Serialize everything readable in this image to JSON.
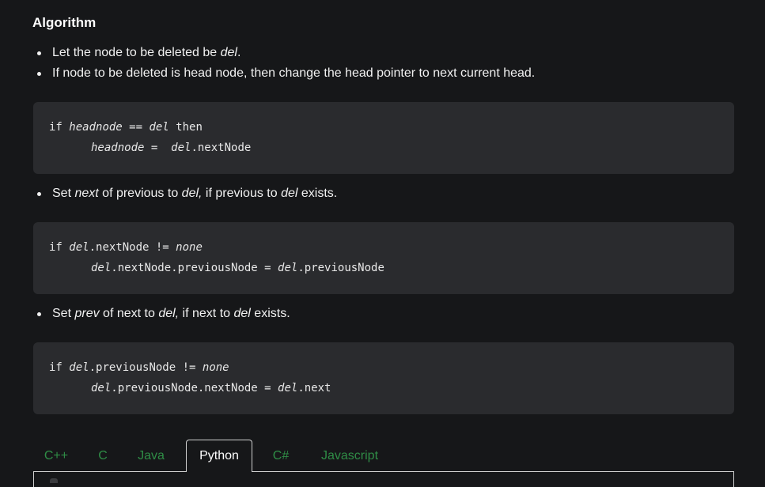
{
  "heading": "Algorithm",
  "bullets1": {
    "b1": {
      "t1": "Let the node to be deleted be ",
      "i1": "del",
      "t2": "."
    },
    "b2": {
      "t1": "If node to be deleted is head node, then change the head pointer to next current head."
    }
  },
  "code1": {
    "l1": {
      "kw": "if ",
      "v1": "headnode",
      "op": " == ",
      "v2": "del",
      "t": " then"
    },
    "l2": {
      "v1": "headnode",
      "op": " =  ",
      "v2": "del",
      "t": ".nextNode"
    }
  },
  "bullet2": {
    "t1": "Set ",
    "i1": "next",
    "t2": " of previous to ",
    "i2": "del,",
    "t3": " if previous to ",
    "i3": "del",
    "t4": " exists."
  },
  "code2": {
    "l1": {
      "kw": "if ",
      "v1": "del",
      "t": ".nextNode != ",
      "v2": "none"
    },
    "l2": {
      "v1": "del",
      "t1": ".nextNode.previousNode = ",
      "v2": "del",
      "t2": ".previousNode"
    }
  },
  "bullet3": {
    "t1": "Set ",
    "i1": "prev",
    "t2": " of next to ",
    "i2": "del,",
    "t3": " if next to ",
    "i3": "del",
    "t4": " exists."
  },
  "code3": {
    "l1": {
      "kw": "if ",
      "v1": "del",
      "t": ".previousNode != ",
      "v2": "none"
    },
    "l2": {
      "v1": "del",
      "t1": ".previousNode.nextNode = ",
      "v2": "del",
      "t2": ".next"
    }
  },
  "tabs": {
    "cpp": "C++",
    "c": "C",
    "java": "Java",
    "python": "Python",
    "csharp": "C#",
    "javascript": "Javascript",
    "active": "Python"
  },
  "colors": {
    "background": "#161719",
    "code_background": "#2a2b2e",
    "tab_accent": "#2f8d46"
  }
}
